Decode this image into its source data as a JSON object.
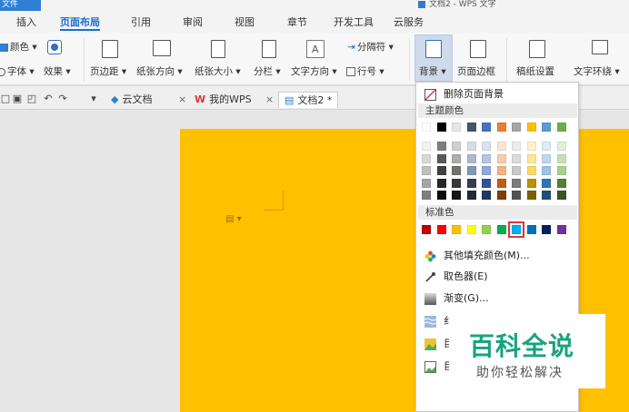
{
  "window": {
    "file_tab": "文件",
    "doc_title": "文档2 - WPS 文字"
  },
  "menu_tabs": [
    {
      "label": "插入"
    },
    {
      "label": "页面布局"
    },
    {
      "label": "引用"
    },
    {
      "label": "审阅"
    },
    {
      "label": "视图"
    },
    {
      "label": "章节"
    },
    {
      "label": "开发工具"
    },
    {
      "label": "云服务"
    }
  ],
  "ribbon": {
    "color": "颜色 ▾",
    "font": "字体 ▾",
    "effect": "效果 ▾",
    "margins": "页边距 ▾",
    "orientation": "纸张方向 ▾",
    "size": "纸张大小 ▾",
    "columns": "分栏 ▾",
    "text_direction": "文字方向 ▾",
    "separator": "分隔符 ▾",
    "line_number": "行号 ▾",
    "background": "背景 ▾",
    "page_border": "页面边框",
    "paper_setup": "稿纸设置",
    "text_wrap": "文字环绕 ▾"
  },
  "doc_tabs": {
    "cloud": "云文档",
    "mywps": "我的WPS",
    "doc2": "文档2 *",
    "close": "×"
  },
  "dropdown": {
    "remove_bg": "删除页面背景",
    "theme_colors": "主题颜色",
    "standard_colors": "标准色",
    "more_fill": "其他填充颜色(M)...",
    "eyedropper": "取色器(E)",
    "gradient": "渐变(G)...",
    "texture_partial": "纟",
    "item5_partial": "目",
    "item6_partial": "目"
  },
  "swatches": {
    "theme_top": [
      "#ffffff",
      "#000000",
      "#e7e6e6",
      "#44546a",
      "#4472c4",
      "#ed7d31",
      "#a5a5a5",
      "#ffc000",
      "#5b9bd5",
      "#70ad47"
    ],
    "theme_shades": [
      [
        "#f2f2f2",
        "#7f7f7f",
        "#d0cece",
        "#d6dce4",
        "#d9e2f3",
        "#fbe5d5",
        "#ededed",
        "#fff2cc",
        "#deebf6",
        "#e2efd9"
      ],
      [
        "#d8d8d8",
        "#595959",
        "#aeabab",
        "#adb9ca",
        "#b4c6e7",
        "#f7cbac",
        "#dbdbdb",
        "#fee599",
        "#bdd7ee",
        "#c5e0b3"
      ],
      [
        "#bfbfbf",
        "#3f3f3f",
        "#757070",
        "#8496b0",
        "#8eaadb",
        "#f4b183",
        "#c9c9c9",
        "#ffd965",
        "#9cc3e5",
        "#a8d08d"
      ],
      [
        "#a5a5a5",
        "#262626",
        "#3a3838",
        "#323f4f",
        "#2f5496",
        "#c55a11",
        "#7b7b7b",
        "#bf9000",
        "#2e75b5",
        "#538135"
      ],
      [
        "#7f7f7f",
        "#0c0c0c",
        "#171616",
        "#222a35",
        "#1f3864",
        "#833c0b",
        "#525252",
        "#7f6000",
        "#1e4e79",
        "#375623"
      ]
    ],
    "standard": [
      "#c00000",
      "#ff0000",
      "#ffc000",
      "#ffff00",
      "#92d050",
      "#00b050",
      "#00b0f0",
      "#0070c0",
      "#002060",
      "#7030a0"
    ]
  },
  "page_color": "#ffc000",
  "accent": "#1a6fd1",
  "watermark": {
    "main": "百科全说",
    "sub": "助你轻松解决"
  }
}
